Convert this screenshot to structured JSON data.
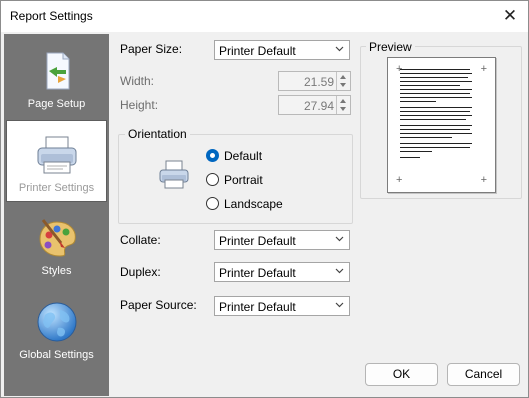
{
  "window": {
    "title": "Report Settings",
    "close_glyph": "✕"
  },
  "sidebar": {
    "items": [
      {
        "label": "Page Setup",
        "icon": "page-setup-icon",
        "active": false
      },
      {
        "label": "Printer Settings",
        "icon": "printer-icon",
        "active": true
      },
      {
        "label": "Styles",
        "icon": "palette-icon",
        "active": false
      },
      {
        "label": "Global Settings",
        "icon": "globe-icon",
        "active": false
      }
    ]
  },
  "form": {
    "paper_size": {
      "label": "Paper Size:",
      "value": "Printer Default"
    },
    "width": {
      "label": "Width:",
      "value": "21.59"
    },
    "height": {
      "label": "Height:",
      "value": "27.94"
    },
    "orientation": {
      "title": "Orientation",
      "options": [
        {
          "label": "Default",
          "checked": true
        },
        {
          "label": "Portrait",
          "checked": false
        },
        {
          "label": "Landscape",
          "checked": false
        }
      ]
    },
    "collate": {
      "label": "Collate:",
      "value": "Printer Default"
    },
    "duplex": {
      "label": "Duplex:",
      "value": "Printer Default"
    },
    "paper_source": {
      "label": "Paper Source:",
      "value": "Printer Default"
    }
  },
  "preview": {
    "title": "Preview"
  },
  "buttons": {
    "ok": "OK",
    "cancel": "Cancel"
  },
  "colors": {
    "sidebar_bg": "#757575",
    "radio_accent": "#0067c0",
    "window_bg": "#f0f0f0"
  }
}
